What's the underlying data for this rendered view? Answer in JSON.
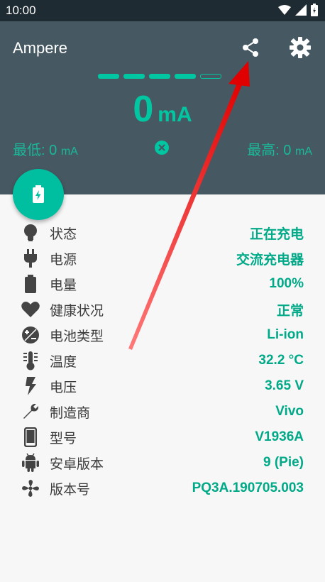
{
  "status_bar": {
    "time": "10:00"
  },
  "app": {
    "title": "Ampere"
  },
  "meter": {
    "current_value": "0",
    "current_unit": "mA",
    "gauge_filled_segments": 4,
    "gauge_total_segments": 5,
    "min_label": "最低: 0",
    "max_label": "最高: 0",
    "minmax_unit": "mA"
  },
  "info": [
    {
      "icon": "lightbulb-icon",
      "label": "状态",
      "value": "正在充电"
    },
    {
      "icon": "plug-icon",
      "label": "电源",
      "value": "交流充电器"
    },
    {
      "icon": "battery-icon",
      "label": "电量",
      "value": "100%"
    },
    {
      "icon": "heart-icon",
      "label": "健康状况",
      "value": "正常"
    },
    {
      "icon": "battery-type-icon",
      "label": "电池类型",
      "value": "Li-ion"
    },
    {
      "icon": "thermometer-icon",
      "label": "温度",
      "value": "32.2 °C"
    },
    {
      "icon": "flash-icon",
      "label": "电压",
      "value": "3.65 V"
    },
    {
      "icon": "wrench-icon",
      "label": "制造商",
      "value": "Vivo"
    },
    {
      "icon": "phone-icon",
      "label": "型号",
      "value": "V1936A"
    },
    {
      "icon": "android-icon",
      "label": "安卓版本",
      "value": "9 (Pie)"
    },
    {
      "icon": "fan-icon",
      "label": "版本号",
      "value": "PQ3A.190705.003"
    }
  ],
  "colors": {
    "header": "#465861",
    "accent": "#00c6a2",
    "value_text": "#00a987"
  }
}
